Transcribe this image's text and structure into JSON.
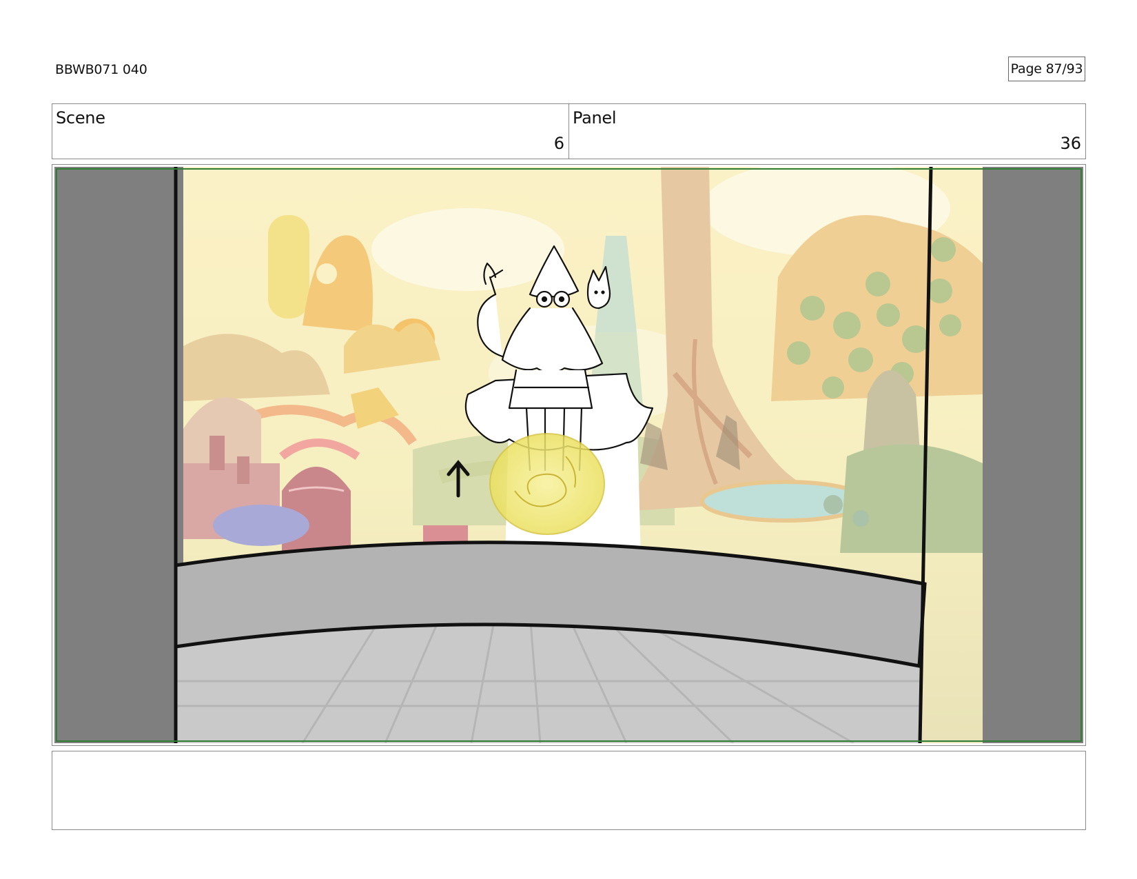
{
  "header": {
    "doc_id": "BBWB071 040",
    "page_label": "Page 87/93"
  },
  "info": {
    "scene_label": "Scene",
    "scene_value": "6",
    "panel_label": "Panel",
    "panel_value": "36"
  },
  "panel": {
    "colors": {
      "letterbox": "#7f7f7f",
      "safe_frame": "#2e7d32",
      "stage_wall": "#b3b3b3",
      "stage_floor": "#c8c8c8",
      "orb": "#f3ea78"
    },
    "icons": [
      "up-arrow-icon"
    ]
  },
  "notes": {
    "text": ""
  }
}
